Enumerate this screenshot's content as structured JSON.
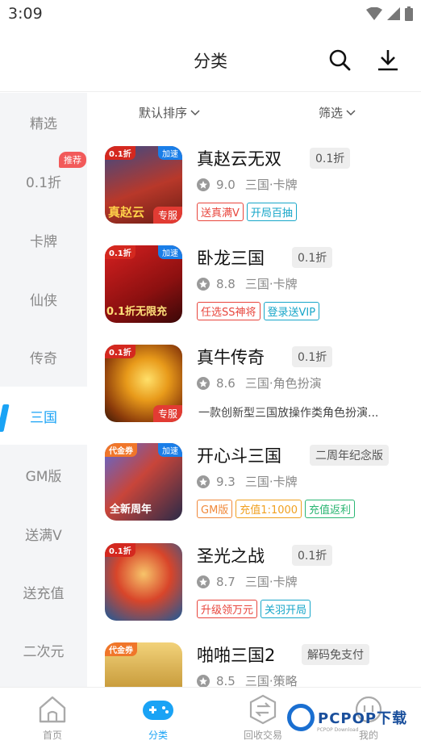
{
  "status_bar": {
    "time": "3:09"
  },
  "header": {
    "title": "分类"
  },
  "sidebar": {
    "items": [
      {
        "label": "精选"
      },
      {
        "label": "0.1折",
        "badge": "推荐"
      },
      {
        "label": "卡牌"
      },
      {
        "label": "仙侠"
      },
      {
        "label": "传奇"
      },
      {
        "label": "三国"
      },
      {
        "label": "GM版"
      },
      {
        "label": "送满V"
      },
      {
        "label": "送充值"
      },
      {
        "label": "二次元"
      }
    ],
    "active_index": 5
  },
  "filters": {
    "sort_label": "默认排序",
    "filter_label": "筛选"
  },
  "games": [
    {
      "name": "真赵云无双",
      "badge": "0.1折",
      "score": "9.0",
      "category": "三国·卡牌",
      "icon_tag_left": "0.1折",
      "icon_tag_right": "加速",
      "icon_tag_bottom": "专服",
      "icon_text": "真赵云",
      "tags": [
        {
          "label": "送真满V",
          "color": "#e8453c"
        },
        {
          "label": "开局百抽",
          "color": "#17a6c9"
        }
      ]
    },
    {
      "name": "卧龙三国",
      "badge": "0.1折",
      "score": "8.8",
      "category": "三国·卡牌",
      "icon_tag_left": "0.1折",
      "icon_tag_right": "加速",
      "icon_text": "0.1折无限充",
      "tags": [
        {
          "label": "任选SS神将",
          "color": "#e8453c"
        },
        {
          "label": "登录送VIP",
          "color": "#17a6c9"
        }
      ]
    },
    {
      "name": "真牛传奇",
      "badge": "0.1折",
      "score": "8.6",
      "category": "三国·角色扮演",
      "icon_tag_left": "0.1折",
      "icon_tag_bottom": "专服",
      "description": "一款创新型三国放操作类角色扮演..."
    },
    {
      "name": "开心斗三国",
      "badge": "二周年纪念版",
      "score": "9.3",
      "category": "三国·卡牌",
      "icon_tag_left": "代金券",
      "icon_tag_right": "加速",
      "icon_text": "全新周年",
      "tags": [
        {
          "label": "GM版",
          "color": "#f0883a"
        },
        {
          "label": "充值1:1000",
          "color": "#f0a020"
        },
        {
          "label": "充值返利",
          "color": "#2bb673"
        }
      ]
    },
    {
      "name": "圣光之战",
      "badge": "0.1折",
      "score": "8.7",
      "category": "三国·卡牌",
      "icon_tag_left": "0.1折",
      "tags": [
        {
          "label": "升级领万元",
          "color": "#e8453c"
        },
        {
          "label": "关羽开局",
          "color": "#17a6c9"
        }
      ]
    },
    {
      "name": "啪啪三国2",
      "badge": "解码免支付",
      "score": "8.5",
      "category": "三国·策略",
      "icon_tag_left": "代金券"
    }
  ],
  "tabbar": {
    "items": [
      {
        "label": "首页",
        "icon": "home-icon"
      },
      {
        "label": "分类",
        "icon": "gamepad-icon"
      },
      {
        "label": "回收交易",
        "icon": "exchange-icon"
      },
      {
        "label": "我的",
        "icon": "profile-icon"
      }
    ],
    "active_index": 1
  },
  "watermark": {
    "text": "PCPOP下载",
    "sub": "PCPOP Download"
  },
  "colors": {
    "accent": "#1aa3f5",
    "badge_red": "#f25a5a",
    "sidebar_bg": "#f4f5f7"
  }
}
